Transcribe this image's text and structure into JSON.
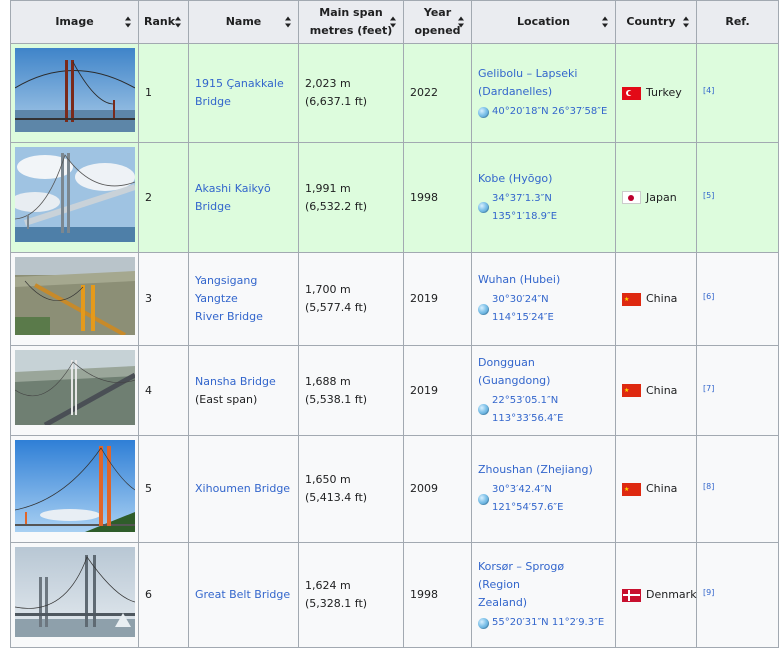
{
  "table": {
    "headers": {
      "image": "Image",
      "rank": "Rank",
      "name": "Name",
      "span_line1": "Main span",
      "span_line2": "metres (feet)",
      "year_line1": "Year",
      "year_line2": "opened",
      "location": "Location",
      "country": "Country",
      "ref": "Ref."
    },
    "rows": [
      {
        "rank": "1",
        "name_line1": "1915 Çanakkale",
        "name_line2": "Bridge",
        "span_m": "2,023 m",
        "span_ft": "(6,637.1 ft)",
        "year": "2022",
        "location_line1": "Gelibolu – Lapseki",
        "location_line2": "(Dardanelles)",
        "coords": "40°20′18″N 26°37′58″E",
        "country": "Turkey",
        "ref": "[4]",
        "highlight": true
      },
      {
        "rank": "2",
        "name_line1": "Akashi Kaikyō",
        "name_line2": "Bridge",
        "span_m": "1,991 m",
        "span_ft": "(6,532.2 ft)",
        "year": "1998",
        "location_line1": "Kobe (Hyōgo)",
        "location_line2": "",
        "coords": "34°37′1.3″N 135°1′18.9″E",
        "country": "Japan",
        "ref": "[5]",
        "highlight": true
      },
      {
        "rank": "3",
        "name_line1": "Yangsigang Yangtze",
        "name_line2": "River Bridge",
        "span_m": "1,700 m",
        "span_ft": "(5,577.4 ft)",
        "year": "2019",
        "location_line1": "Wuhan (Hubei)",
        "location_line2": "",
        "coords": "30°30′24″N 114°15′24″E",
        "country": "China",
        "ref": "[6]",
        "highlight": false
      },
      {
        "rank": "4",
        "name_line1": "Nansha Bridge",
        "name_line2": "(East span)",
        "span_m": "1,688 m",
        "span_ft": "(5,538.1 ft)",
        "year": "2019",
        "location_line1": "Dongguan (Guangdong)",
        "location_line2": "",
        "coords": "22°53′05.1″N 113°33′56.4″E",
        "country": "China",
        "ref": "[7]",
        "highlight": false
      },
      {
        "rank": "5",
        "name_line1": "Xihoumen Bridge",
        "name_line2": "",
        "span_m": "1,650 m",
        "span_ft": "(5,413.4 ft)",
        "year": "2009",
        "location_line1": "Zhoushan (Zhejiang)",
        "location_line2": "",
        "coords": "30°3′42.4″N 121°54′57.6″E",
        "country": "China",
        "ref": "[8]",
        "highlight": false
      },
      {
        "rank": "6",
        "name_line1": "Great Belt Bridge",
        "name_line2": "",
        "span_m": "1,624 m",
        "span_ft": "(5,328.1 ft)",
        "year": "1998",
        "location_line1": "Korsør – Sprogø (Region",
        "location_line2": "Zealand)",
        "coords": "55°20′31″N 11°2′9.3″E",
        "country": "Denmark",
        "ref": "[9]",
        "highlight": false
      }
    ]
  },
  "colors": {
    "header_bg": "#eaecf0",
    "highlight_row_bg": "#ddfcdd",
    "link": "#3366cc",
    "border": "#a2a9b1"
  }
}
